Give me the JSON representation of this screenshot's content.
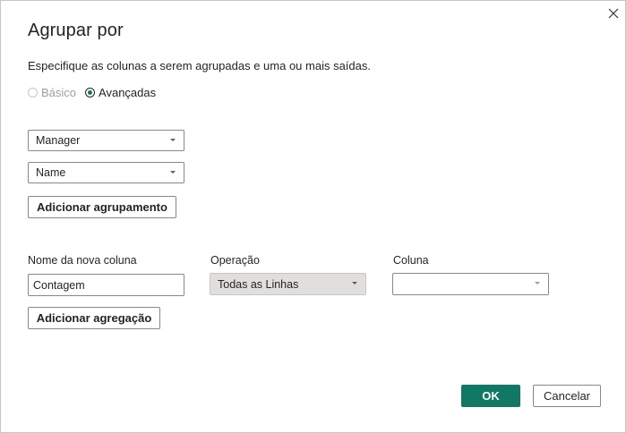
{
  "dialog": {
    "title": "Agrupar por",
    "description": "Especifique as colunas a serem agrupadas e uma ou mais saídas.",
    "close_icon": "close-icon"
  },
  "mode": {
    "basic_label": "Básico",
    "advanced_label": "Avançadas",
    "selected": "advanced"
  },
  "grouping": {
    "columns": [
      "Manager",
      "Name"
    ],
    "add_button": "Adicionar agrupamento"
  },
  "aggregation": {
    "new_column_label": "Nome da nova coluna",
    "operation_label": "Operação",
    "column_label": "Coluna",
    "new_column_value": "Contagem",
    "operation_value": "Todas as Linhas",
    "column_value": "",
    "add_button": "Adicionar agregação"
  },
  "footer": {
    "ok": "OK",
    "cancel": "Cancelar"
  },
  "colors": {
    "accent": "#117865"
  }
}
